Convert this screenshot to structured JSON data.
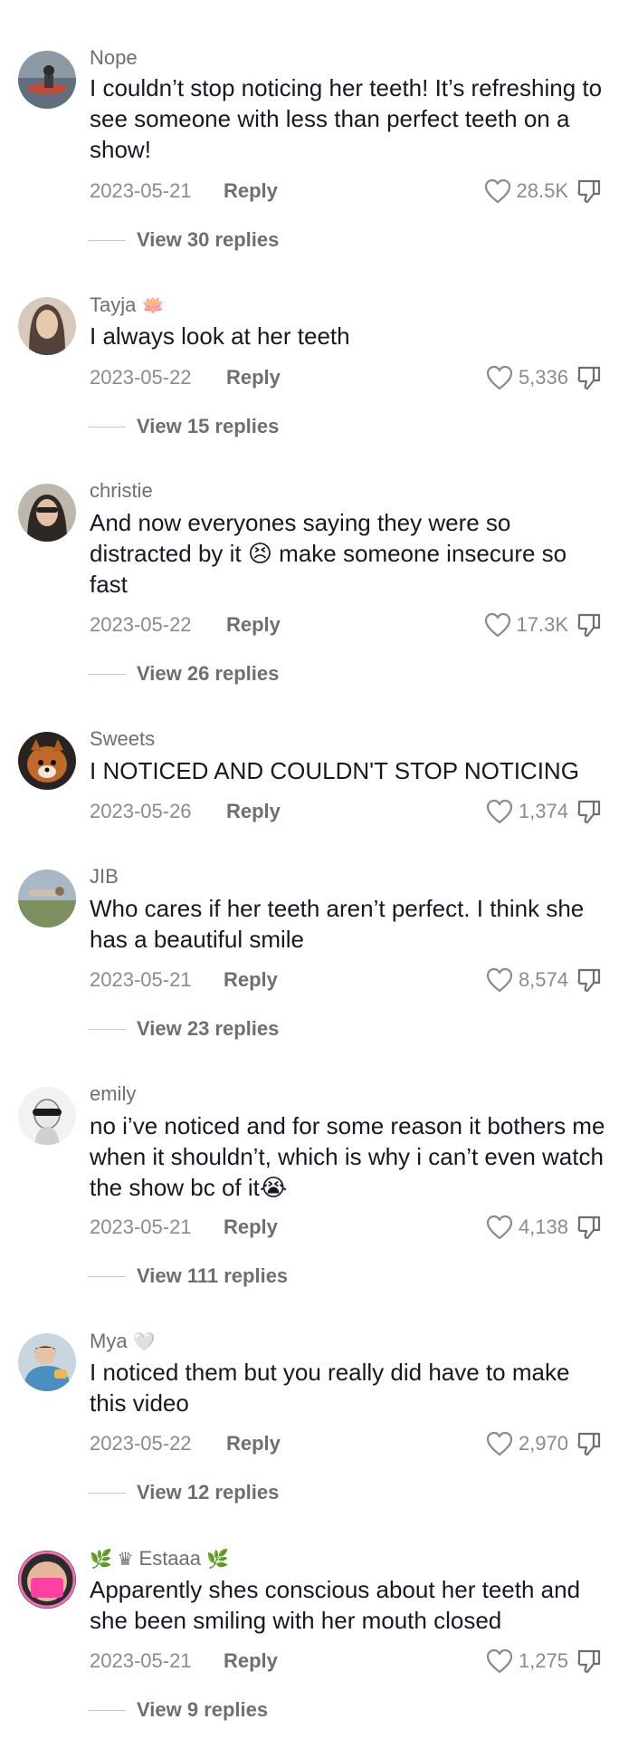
{
  "comments": [
    {
      "username": "Nope",
      "username_prefix_emoji": "",
      "username_suffix_emoji": "",
      "text": "I couldn’t stop noticing her teeth! It’s refreshing to see someone with less than perfect teeth on a show!",
      "date": "2023-05-21",
      "reply_label": "Reply",
      "likes": "28.5K",
      "view_replies": "View 30 replies"
    },
    {
      "username": "Tayja",
      "username_prefix_emoji": "",
      "username_suffix_emoji": "🪷",
      "text": "I always look at her teeth",
      "date": "2023-05-22",
      "reply_label": "Reply",
      "likes": "5,336",
      "view_replies": "View 15 replies"
    },
    {
      "username": "christie",
      "username_prefix_emoji": "",
      "username_suffix_emoji": "",
      "text": "And now everyones saying they were so distracted by it 😣 make someone insecure so fast",
      "date": "2023-05-22",
      "reply_label": "Reply",
      "likes": "17.3K",
      "view_replies": "View 26 replies"
    },
    {
      "username": "Sweets",
      "username_prefix_emoji": "",
      "username_suffix_emoji": "",
      "text": "I NOTICED AND COULDN'T STOP NOTICING",
      "date": "2023-05-26",
      "reply_label": "Reply",
      "likes": "1,374",
      "view_replies": ""
    },
    {
      "username": "JIB",
      "username_prefix_emoji": "",
      "username_suffix_emoji": "",
      "text": "Who cares if her teeth aren’t perfect. I think she has a beautiful smile",
      "date": "2023-05-21",
      "reply_label": "Reply",
      "likes": "8,574",
      "view_replies": "View 23 replies"
    },
    {
      "username": "emily",
      "username_prefix_emoji": "",
      "username_suffix_emoji": "",
      "text": "no i’ve noticed and for some reason it bothers me when it shouldn’t, which is why i can’t even watch the show bc of it😭",
      "date": "2023-05-21",
      "reply_label": "Reply",
      "likes": "4,138",
      "view_replies": "View 111 replies"
    },
    {
      "username": "Mya",
      "username_prefix_emoji": "",
      "username_suffix_emoji": "🤍",
      "text": "I noticed them but you really did have to make this video",
      "date": "2023-05-22",
      "reply_label": "Reply",
      "likes": "2,970",
      "view_replies": "View 12 replies"
    },
    {
      "username": "Estaaa",
      "username_prefix_emoji": "🌿 ♛",
      "username_suffix_emoji": "🌿",
      "text": "Apparently shes conscious about her teeth and she been smiling with her mouth closed",
      "date": "2023-05-21",
      "reply_label": "Reply",
      "likes": "1,275",
      "view_replies": "View 9 replies"
    }
  ],
  "colors": {
    "text": "#161823",
    "secondary": "#8a8b91",
    "username": "#6e6e73"
  },
  "icons": {
    "like": "heart-outline-icon",
    "dislike": "thumbs-down-icon"
  }
}
